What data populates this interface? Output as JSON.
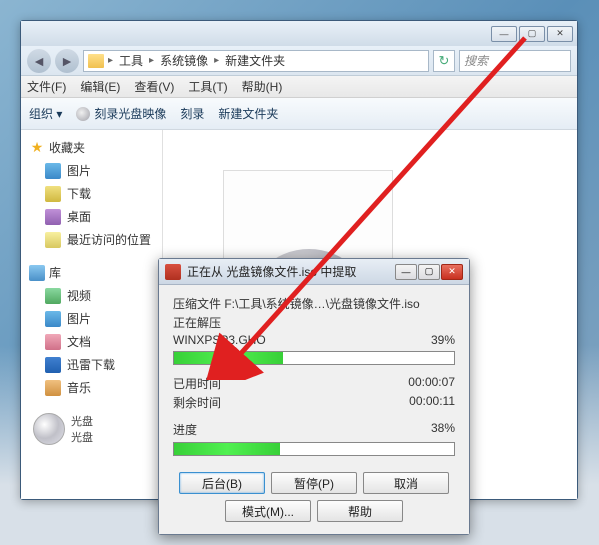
{
  "window": {
    "min": "—",
    "max": "▢",
    "close": "✕"
  },
  "breadcrumb": {
    "item1": "工具",
    "item2": "系统镜像",
    "item3": "新建文件夹"
  },
  "search": {
    "placeholder": "搜索"
  },
  "menu": {
    "file": "文件(F)",
    "edit": "编辑(E)",
    "view": "查看(V)",
    "tools": "工具(T)",
    "help": "帮助(H)"
  },
  "toolbar": {
    "organize": "组织 ▾",
    "burn": "刻录光盘映像",
    "burn2": "刻录",
    "newfolder": "新建文件夹"
  },
  "sidebar": {
    "fav": "收藏夹",
    "items_fav": [
      "图片",
      "下载",
      "桌面",
      "最近访问的位置"
    ],
    "lib": "库",
    "items_lib": [
      "视频",
      "图片",
      "文档",
      "迅雷下载",
      "音乐"
    ],
    "iso": {
      "l1": "光盘",
      "l2": "光盘"
    }
  },
  "dialog": {
    "title": "正在从 光盘镜像文件.iso 中提取",
    "path_label": "压缩文件 F:\\工具\\系统镜像…\\光盘镜像文件.iso",
    "extracting": "正在解压",
    "filename": "WINXPSP3.GHO",
    "pct1": "39%",
    "elapsed_label": "已用时间",
    "elapsed_val": "00:00:07",
    "remain_label": "剩余时间",
    "remain_val": "00:00:11",
    "progress_label": "进度",
    "pct2": "38%",
    "buttons": {
      "bg": "后台(B)",
      "pause": "暂停(P)",
      "cancel": "取消",
      "mode": "模式(M)...",
      "help": "帮助"
    }
  }
}
